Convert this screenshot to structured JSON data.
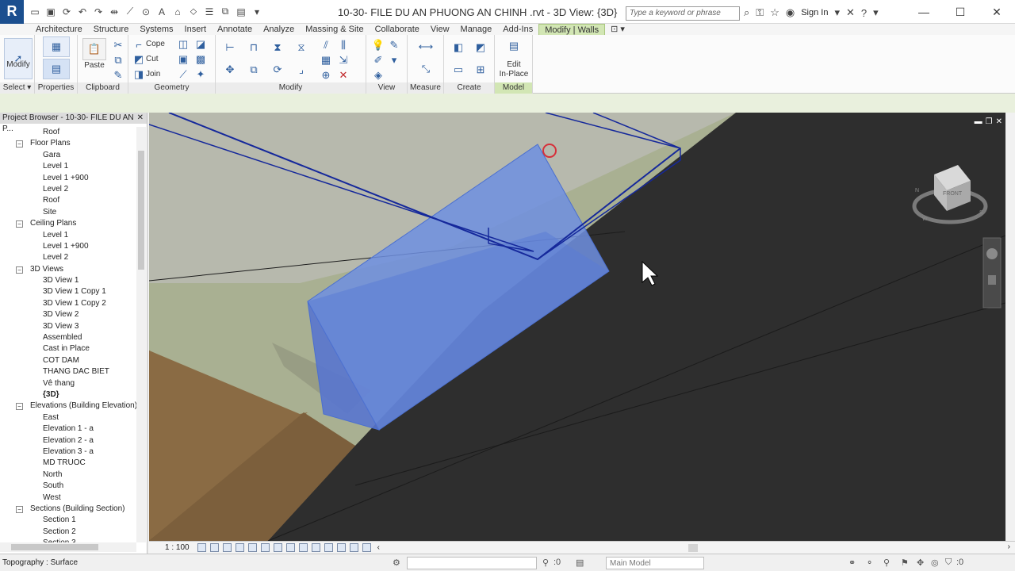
{
  "app": {
    "logo": "R",
    "title": "10-30- FILE DU AN PHUONG AN CHINH .rvt - 3D View: {3D}"
  },
  "search": {
    "placeholder": "Type a keyword or phrase"
  },
  "account": {
    "signin": "Sign In"
  },
  "tabs": [
    "Architecture",
    "Structure",
    "Systems",
    "Insert",
    "Annotate",
    "Analyze",
    "Massing & Site",
    "Collaborate",
    "View",
    "Manage",
    "Add-Ins",
    "Modify | Walls"
  ],
  "ribbon": {
    "select_label": "Select",
    "modify_label": "Modify",
    "properties_label": "Properties",
    "clipboard": {
      "title": "Clipboard",
      "paste": "Paste",
      "cope": "Cope",
      "cut": "Cut",
      "join": "Join"
    },
    "geometry_title": "Geometry",
    "modify_title": "Modify",
    "view_title": "View",
    "measure_title": "Measure",
    "create_title": "Create",
    "model": {
      "title": "Model",
      "edit_line1": "Edit",
      "edit_line2": "In-Place"
    }
  },
  "browser": {
    "title": "Project Browser - 10-30- FILE DU AN P...",
    "nodes": [
      {
        "label": "Roof",
        "level": 1
      },
      {
        "label": "Floor Plans",
        "level": 0,
        "expander": "−"
      },
      {
        "label": "Gara",
        "level": 1
      },
      {
        "label": "Level 1",
        "level": 1
      },
      {
        "label": "Level 1 +900",
        "level": 1
      },
      {
        "label": "Level 2",
        "level": 1
      },
      {
        "label": "Roof",
        "level": 1
      },
      {
        "label": "Site",
        "level": 1
      },
      {
        "label": "Ceiling Plans",
        "level": 0,
        "expander": "−"
      },
      {
        "label": "Level 1",
        "level": 1
      },
      {
        "label": "Level 1 +900",
        "level": 1
      },
      {
        "label": "Level 2",
        "level": 1
      },
      {
        "label": "3D Views",
        "level": 0,
        "expander": "−"
      },
      {
        "label": "3D View 1",
        "level": 1
      },
      {
        "label": "3D View 1 Copy 1",
        "level": 1
      },
      {
        "label": "3D View 1 Copy 2",
        "level": 1
      },
      {
        "label": "3D View 2",
        "level": 1
      },
      {
        "label": "3D View 3",
        "level": 1
      },
      {
        "label": "Assembled",
        "level": 1
      },
      {
        "label": "Cast in Place",
        "level": 1
      },
      {
        "label": "COT DAM",
        "level": 1
      },
      {
        "label": "THANG DAC BIET",
        "level": 1
      },
      {
        "label": "Vê thang",
        "level": 1
      },
      {
        "label": "{3D}",
        "level": 1,
        "bold": true
      },
      {
        "label": "Elevations (Building Elevation)",
        "level": 0,
        "expander": "−"
      },
      {
        "label": "East",
        "level": 1
      },
      {
        "label": "Elevation 1 - a",
        "level": 1
      },
      {
        "label": "Elevation 2 - a",
        "level": 1
      },
      {
        "label": "Elevation 3 - a",
        "level": 1
      },
      {
        "label": "MD TRUOC",
        "level": 1
      },
      {
        "label": "North",
        "level": 1
      },
      {
        "label": "South",
        "level": 1
      },
      {
        "label": "West",
        "level": 1
      },
      {
        "label": "Sections (Building Section)",
        "level": 0,
        "expander": "−"
      },
      {
        "label": "Section 1",
        "level": 1
      },
      {
        "label": "Section 2",
        "level": 1
      },
      {
        "label": "Section 3",
        "level": 1
      }
    ]
  },
  "viewcube": {
    "face": "FRONT",
    "compass": [
      "S",
      "W",
      "N"
    ]
  },
  "viewbar": {
    "scale": "1 : 100"
  },
  "status": {
    "text": "Topography : Surface",
    "count": ":0",
    "model": "Main Model",
    "filter": ":0"
  },
  "colors": {
    "accent": "#1b4f8f",
    "selection": "#6f8fe0",
    "tab_active": "#d2e6b4"
  }
}
